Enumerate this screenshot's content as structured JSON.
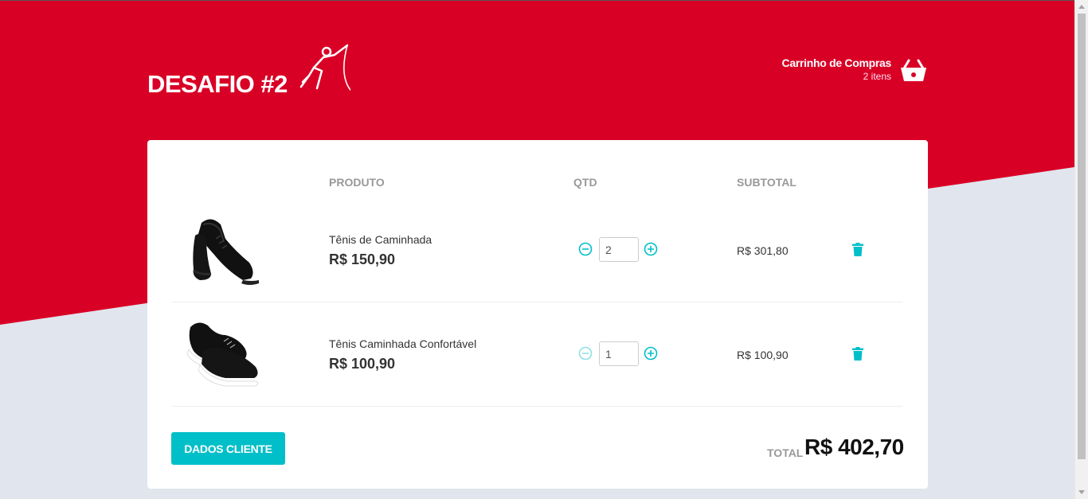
{
  "header": {
    "title": "DESAFIO #2",
    "logo_icon": "fencer-icon",
    "cart": {
      "label": "Carrinho de Compras",
      "count": "2 itens",
      "icon": "basket-icon"
    }
  },
  "table": {
    "columns": {
      "product": "PRODUTO",
      "qty": "QTD",
      "subtotal": "SUBTOTAL"
    },
    "rows": [
      {
        "name": "Tênis de Caminhada",
        "price": "R$ 150,90",
        "qty": "2",
        "subtotal": "R$ 301,80",
        "image": "black-sneaker-image"
      },
      {
        "name": "Tênis Caminhada Confortável",
        "price": "R$ 100,90",
        "qty": "1",
        "subtotal": "R$ 100,90",
        "image": "black-white-sneaker-image"
      }
    ]
  },
  "footer": {
    "button_label": "DADOS CLIENTE",
    "total_label": "TOTAL",
    "total_value": "R$ 402,70"
  },
  "colors": {
    "brand_red": "#d90026",
    "accent_teal": "#00bfc8",
    "background": "#e1e5ed"
  }
}
